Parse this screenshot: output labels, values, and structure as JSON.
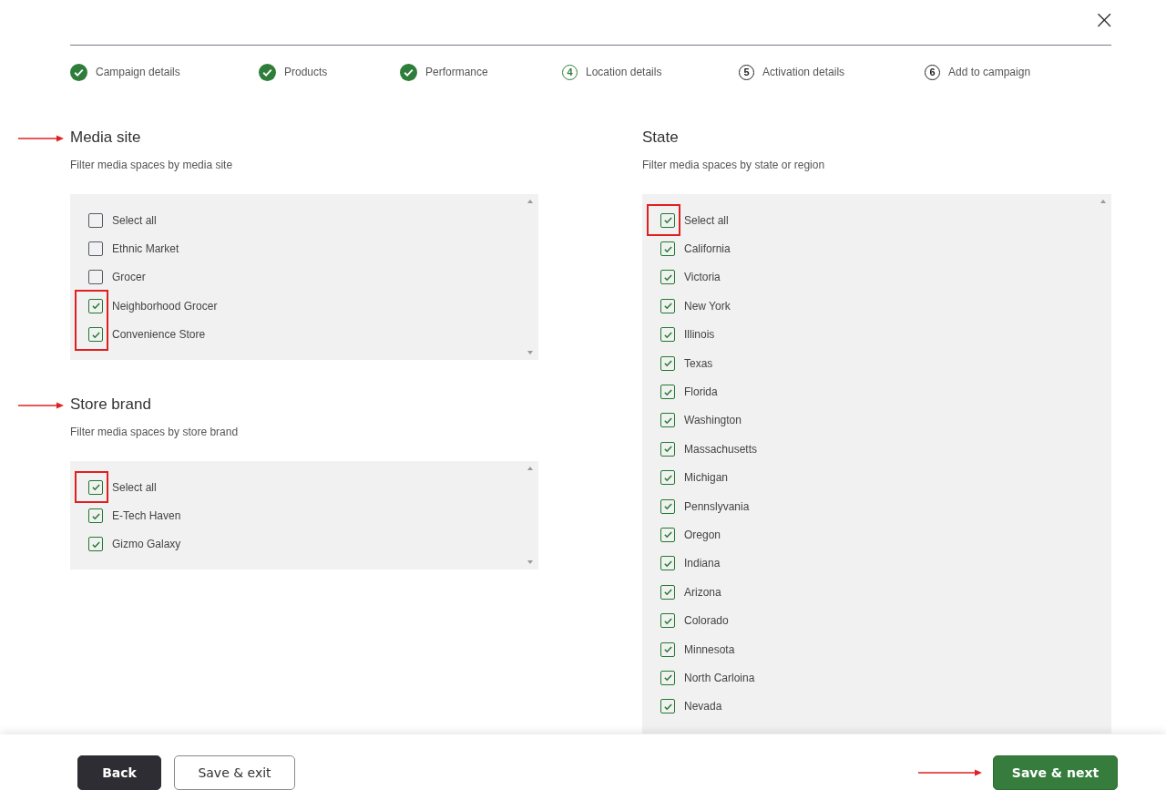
{
  "close_label": "×",
  "steps": [
    {
      "label": "Campaign details",
      "completed": true
    },
    {
      "label": "Products",
      "completed": true
    },
    {
      "label": "Performance",
      "completed": true
    },
    {
      "number": "4",
      "label": "Location details",
      "completed": false,
      "current": true
    },
    {
      "number": "5",
      "label": "Activation details",
      "completed": false,
      "current": false
    },
    {
      "number": "6",
      "label": "Add to campaign",
      "completed": false,
      "current": false
    }
  ],
  "left_sections": [
    {
      "title": "Media site",
      "subtitle": "Filter media spaces by media site",
      "annotated": true,
      "items": [
        {
          "label": "Select all",
          "checked": false,
          "highlighted": false
        },
        {
          "label": "Ethnic Market",
          "checked": false,
          "highlighted": false
        },
        {
          "label": "Grocer",
          "checked": false,
          "highlighted": false
        },
        {
          "label": "Neighborhood Grocer",
          "checked": true,
          "highlighted": true
        },
        {
          "label": "Convenience Store",
          "checked": true,
          "highlighted": true
        }
      ]
    },
    {
      "title": "Store brand",
      "subtitle": "Filter media spaces by store brand",
      "annotated": true,
      "items": [
        {
          "label": "Select all",
          "checked": true,
          "highlighted": true
        },
        {
          "label": "E-Tech Haven",
          "checked": true,
          "highlighted": false
        },
        {
          "label": "Gizmo Galaxy",
          "checked": true,
          "highlighted": false
        }
      ]
    }
  ],
  "state_section": {
    "title": "State",
    "subtitle": "Filter media spaces by state or region",
    "items": [
      {
        "label": "Select all",
        "checked": true,
        "highlighted": true
      },
      {
        "label": "California",
        "checked": true,
        "highlighted": false
      },
      {
        "label": "Victoria",
        "checked": true,
        "highlighted": false
      },
      {
        "label": "New York",
        "checked": true,
        "highlighted": false
      },
      {
        "label": "Illinois",
        "checked": true,
        "highlighted": false
      },
      {
        "label": "Texas",
        "checked": true,
        "highlighted": false
      },
      {
        "label": "Florida",
        "checked": true,
        "highlighted": false
      },
      {
        "label": "Washington",
        "checked": true,
        "highlighted": false
      },
      {
        "label": "Massachusetts",
        "checked": true,
        "highlighted": false
      },
      {
        "label": "Michigan",
        "checked": true,
        "highlighted": false
      },
      {
        "label": "Pennslyvania",
        "checked": true,
        "highlighted": false
      },
      {
        "label": "Oregon",
        "checked": true,
        "highlighted": false
      },
      {
        "label": "Indiana",
        "checked": true,
        "highlighted": false
      },
      {
        "label": "Arizona",
        "checked": true,
        "highlighted": false
      },
      {
        "label": "Colorado",
        "checked": true,
        "highlighted": false
      },
      {
        "label": "Minnesota",
        "checked": true,
        "highlighted": false
      },
      {
        "label": "North Carloina",
        "checked": true,
        "highlighted": false
      },
      {
        "label": "Nevada",
        "checked": true,
        "highlighted": false
      }
    ]
  },
  "footer": {
    "buttons": [
      {
        "label": "Back",
        "kind": "dark"
      },
      {
        "label": "Save & exit",
        "kind": "outline"
      }
    ],
    "primary": {
      "label": "Save & next",
      "kind": "primary",
      "annotated": true
    }
  }
}
